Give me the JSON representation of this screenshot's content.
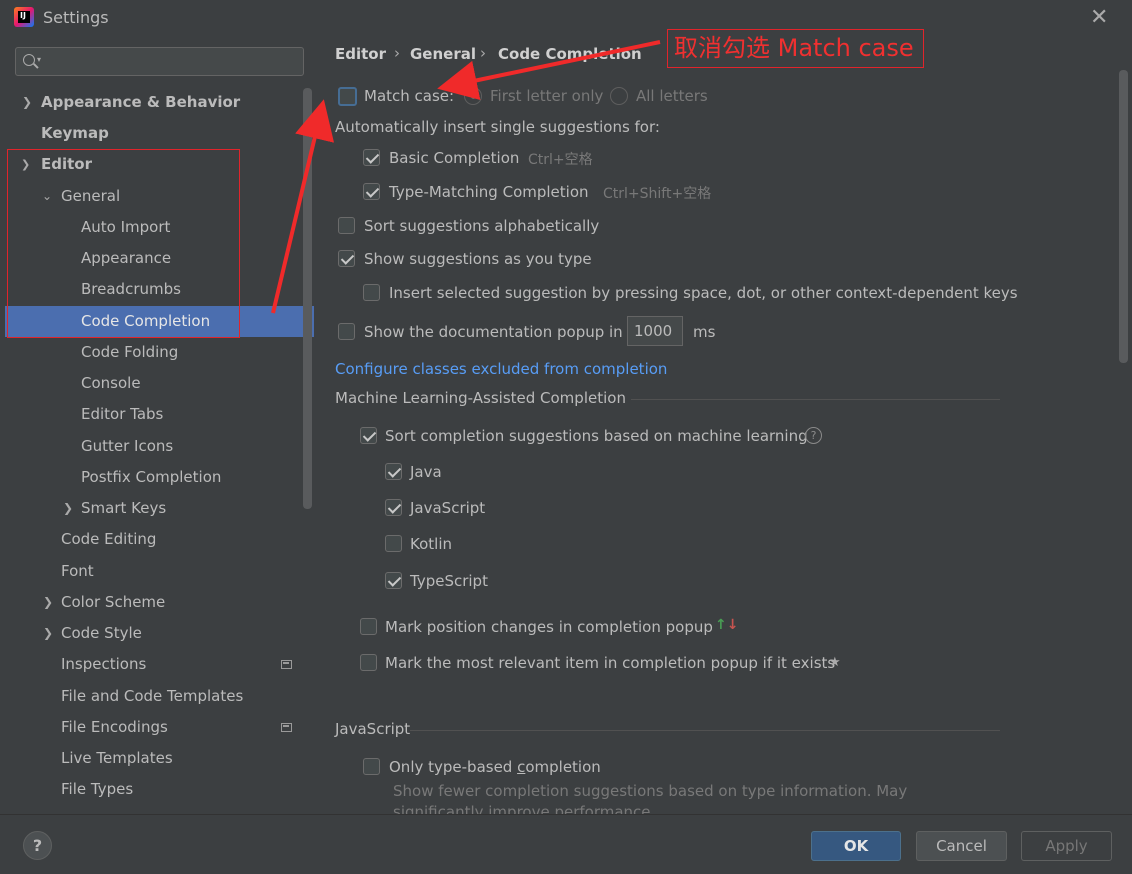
{
  "window": {
    "title": "Settings"
  },
  "sidebar": {
    "search_placeholder": "",
    "items": [
      {
        "label": "Appearance & Behavior"
      },
      {
        "label": "Keymap"
      },
      {
        "label": "Editor"
      },
      {
        "label": "General"
      },
      {
        "label": "Auto Import"
      },
      {
        "label": "Appearance"
      },
      {
        "label": "Breadcrumbs"
      },
      {
        "label": "Code Completion"
      },
      {
        "label": "Code Folding"
      },
      {
        "label": "Console"
      },
      {
        "label": "Editor Tabs"
      },
      {
        "label": "Gutter Icons"
      },
      {
        "label": "Postfix Completion"
      },
      {
        "label": "Smart Keys"
      },
      {
        "label": "Code Editing"
      },
      {
        "label": "Font"
      },
      {
        "label": "Color Scheme"
      },
      {
        "label": "Code Style"
      },
      {
        "label": "Inspections"
      },
      {
        "label": "File and Code Templates"
      },
      {
        "label": "File Encodings"
      },
      {
        "label": "Live Templates"
      },
      {
        "label": "File Types"
      }
    ]
  },
  "breadcrumb": {
    "items": [
      "Editor",
      "General",
      "Code Completion"
    ],
    "separator": "›"
  },
  "annotation": {
    "text": "取消勾选 Match case"
  },
  "settings": {
    "match_case": {
      "label": "Match case:",
      "checked": false
    },
    "first_letter_only": {
      "label": "First letter only",
      "selected": true
    },
    "all_letters": {
      "label": "All letters",
      "selected": false
    },
    "auto_insert_label": "Automatically insert single suggestions for:",
    "basic_completion": {
      "label": "Basic Completion",
      "shortcut": "Ctrl+空格",
      "checked": true
    },
    "type_matching": {
      "label": "Type-Matching Completion",
      "shortcut": "Ctrl+Shift+空格",
      "checked": true
    },
    "sort_alpha": {
      "label": "Sort suggestions alphabetically",
      "checked": false
    },
    "show_as_type": {
      "label": "Show suggestions as you type",
      "checked": true
    },
    "insert_selected": {
      "label": "Insert selected suggestion by pressing space, dot, or other context-dependent keys",
      "checked": false
    },
    "doc_popup": {
      "label": "Show the documentation popup in",
      "value": "1000",
      "unit": "ms",
      "checked": false
    },
    "configure_link": "Configure classes excluded from completion",
    "ml_section": "Machine Learning-Assisted Completion",
    "ml_sort": {
      "label": "Sort completion suggestions based on machine learning",
      "checked": true
    },
    "java": {
      "label": "Java",
      "checked": true
    },
    "javascript": {
      "label": "JavaScript",
      "checked": true
    },
    "kotlin": {
      "label": "Kotlin",
      "checked": false
    },
    "typescript": {
      "label": "TypeScript",
      "checked": true
    },
    "mark_position": {
      "label": "Mark position changes in completion popup",
      "checked": false
    },
    "mark_relevant": {
      "label": "Mark the most relevant item in completion popup if it exists",
      "checked": false
    },
    "js_section": "JavaScript",
    "only_type_based": {
      "label_pre": "Only type-based ",
      "label_u": "c",
      "label_post": "ompletion",
      "checked": false
    },
    "only_type_desc_1": "Show fewer completion suggestions based on type information. May",
    "only_type_desc_2": "significantly improve performance."
  },
  "footer": {
    "help": "?",
    "ok": "OK",
    "cancel": "Cancel",
    "apply": "Apply"
  },
  "colors": {
    "accent": "#4b6eaf",
    "link": "#589df6",
    "annotation_red": "#e0242b",
    "ok_button": "#365880"
  }
}
